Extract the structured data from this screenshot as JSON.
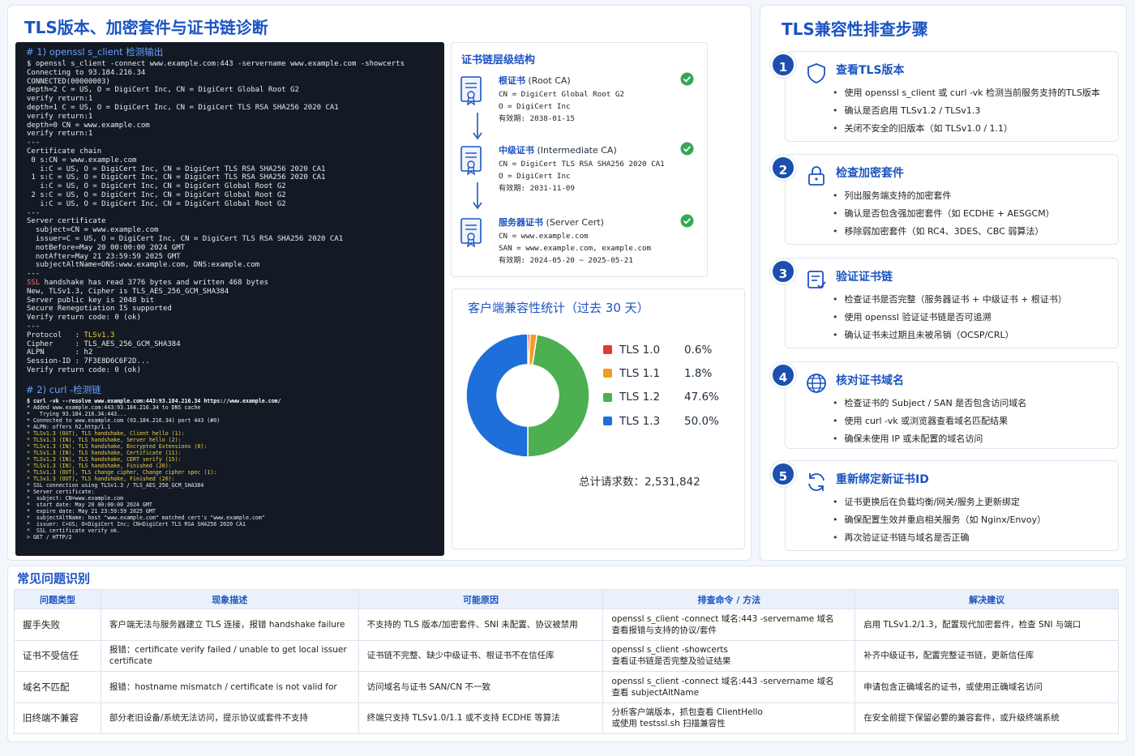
{
  "page_title": "TLS版本、加密套件与证书链诊断",
  "term": {
    "sec1": "# 1) openssl s_client 检测输出",
    "block1": "$ openssl s_client -connect www.example.com:443 -servername www.example.com -showcerts\nConnecting to 93.184.216.34\nCONNECTED(00000003)\ndepth=2 C = US, O = DigiCert Inc, CN = DigiCert Global Root G2\nverify return:1\ndepth=1 C = US, O = DigiCert Inc, CN = DigiCert TLS RSA SHA256 2020 CA1\nverify return:1\ndepth=0 CN = www.example.com\nverify return:1\n---\nCertificate chain\n 0 s:CN = www.example.com\n   i:C = US, O = DigiCert Inc, CN = DigiCert TLS RSA SHA256 2020 CA1\n 1 s:C = US, O = DigiCert Inc, CN = DigiCert TLS RSA SHA256 2020 CA1\n   i:C = US, O = DigiCert Inc, CN = DigiCert Global Root G2\n 2 s:C = US, O = DigiCert Inc, CN = DigiCert Global Root G2\n   i:C = US, O = DigiCert Inc, CN = DigiCert Global Root G2\n---\nServer certificate\n  subject=CN = www.example.com\n  issuer=C = US, O = DigiCert Inc, CN = DigiCert TLS RSA SHA256 2020 CA1\n  notBefore=May 20 00:00:00 2024 GMT\n  notAfter=May 21 23:59:59 2025 GMT\n  subjectAltName=DNS:www.example.com, DNS:example.com\n---",
    "ssl_kw": "SSL",
    "ssl_rest": " handshake has read 3776 bytes and written 468 bytes",
    "block2": "New, TLSv1.3, Cipher is TLS_AES_256_GCM_SHA384\nServer public key is 2048 bit\nSecure Renegotiation IS supported\nVerify return code: 0 (ok)\n---",
    "proto_label": "Protocol   : ",
    "proto_val": "TLSv1.3",
    "block3": "Cipher     : TLS_AES_256_GCM_SHA384\nALPN       : h2\nSession-ID : 7F3E8D6C6F2D...\nVerify return code: 0 (ok)",
    "sec2": "# 2) curl -检测链",
    "curl_cmd": "$ curl -vk --resolve www.example.com:443:93.184.216.34 https://www.example.com/",
    "curl_head": "* Added www.example.com:443:93.184.216.34 to DNS cache\n*   Trying 93.184.216.34:443...\n* Connected to www.example.com (93.184.216.34) port 443 (#0)\n* ALPN: offers h2,http/1.1",
    "curl_tls": "* TLSv1.3 (OUT), TLS handshake, Client hello (1):\n* TLSv1.3 (IN), TLS handshake, Server hello (2):\n* TLSv1.3 (IN), TLS handshake, Encrypted Extensions (8):\n* TLSv1.3 (IN), TLS handshake, Certificate (11):\n* TLSv1.3 (IN), TLS handshake, CERT verify (15):\n* TLSv1.3 (IN), TLS handshake, Finished (20):\n* TLSv1.3 (OUT), TLS change cipher, Change cipher spec (1):\n* TLSv1.3 (OUT), TLS handshake, Finished (20):",
    "curl_tail": "* SSL connection using TLSv1.3 / TLS_AES_256_GCM_SHA384\n* Server certificate:\n*  subject: CN=www.example.com\n*  start date: May 20 00:00:00 2024 GMT\n*  expire date: May 21 23:59:59 2025 GMT\n*  subjectAltName: host \"www.example.com\" matched cert's \"www.example.com\"\n*  issuer: C=US; O=DigiCert Inc; CN=DigiCert TLS RSA SHA256 2020 CA1\n*  SSL certificate verify ok.\n> GET / HTTP/2"
  },
  "chain": {
    "title": "证书链层级结构",
    "certs": [
      {
        "kind": "根证书",
        "en": "(Root CA)",
        "info": "CN = DigiCert Global Root G2\nO = DigiCert Inc\n有效期: 2038-01-15"
      },
      {
        "kind": "中级证书",
        "en": "(Intermediate CA)",
        "info": "CN = DigiCert TLS RSA SHA256 2020 CA1\nO = DigiCert Inc\n有效期: 2031-11-09"
      },
      {
        "kind": "服务器证书",
        "en": "(Server Cert)",
        "info": "CN = www.example.com\nSAN = www.example.com, example.com\n有效期: 2024-05-20 ~ 2025-05-21"
      }
    ]
  },
  "stats": {
    "title": "客户端兼容性统计（过去 30 天）",
    "total_label": "总计请求数：2,531,842"
  },
  "chart_data": {
    "type": "pie",
    "title": "客户端兼容性统计（过去 30 天）",
    "donut": true,
    "categories": [
      "TLS 1.0",
      "TLS 1.1",
      "TLS 1.2",
      "TLS 1.3"
    ],
    "values": [
      0.6,
      1.8,
      47.6,
      50.0
    ],
    "labels": [
      "0.6%",
      "1.8%",
      "47.6%",
      "50.0%"
    ],
    "colors": [
      "#e53935",
      "#f59a23",
      "#4caf50",
      "#1e6fd9"
    ],
    "legend_position": "right"
  },
  "right": {
    "title": "TLS兼容性排查步骤",
    "steps": [
      {
        "num": "1",
        "title": "查看TLS版本",
        "items": [
          "使用 openssl s_client 或 curl -vk 检测当前服务支持的TLS版本",
          "确认是否启用 TLSv1.2 / TLSv1.3",
          "关闭不安全的旧版本（如 TLSv1.0 / 1.1）"
        ]
      },
      {
        "num": "2",
        "title": "检查加密套件",
        "items": [
          "列出服务端支持的加密套件",
          "确认是否包含强加密套件（如 ECDHE + AESGCM）",
          "移除弱加密套件（如 RC4、3DES、CBC 弱算法）"
        ]
      },
      {
        "num": "3",
        "title": "验证证书链",
        "items": [
          "检查证书是否完整（服务器证书 + 中级证书 + 根证书）",
          "使用 openssl 验证证书链是否可追溯",
          "确认证书未过期且未被吊销（OCSP/CRL）"
        ]
      },
      {
        "num": "4",
        "title": "核对证书域名",
        "items": [
          "检查证书的 Subject / SAN 是否包含访问域名",
          "使用 curl -vk 或浏览器查看域名匹配结果",
          "确保未使用 IP 或未配置的域名访问"
        ]
      },
      {
        "num": "5",
        "title": "重新绑定新证书ID",
        "items": [
          "证书更换后在负载均衡/网关/服务上更新绑定",
          "确保配置生效并重启相关服务（如 Nginx/Envoy）",
          "再次验证证书链与域名是否正确"
        ]
      }
    ]
  },
  "problems": {
    "title": "常见问题识别",
    "headers": [
      "问题类型",
      "现象描述",
      "可能原因",
      "排查命令 / 方法",
      "解决建议"
    ],
    "rows": [
      [
        "握手失败",
        "客户端无法与服务器建立 TLS 连接，报错 handshake failure",
        "不支持的 TLS 版本/加密套件、SNI 未配置、协议被禁用",
        "openssl s_client -connect 域名:443 -servername 域名\n查看报错与支持的协议/套件",
        "启用 TLSv1.2/1.3，配置现代加密套件，检查 SNI 与端口"
      ],
      [
        "证书不受信任",
        "报错：certificate verify failed / unable to get local issuer certificate",
        "证书链不完整、缺少中级证书、根证书不在信任库",
        "openssl s_client -showcerts\n查看证书链是否完整及验证结果",
        "补齐中级证书，配置完整证书链，更新信任库"
      ],
      [
        "域名不匹配",
        "报错：hostname mismatch / certificate is not valid for",
        "访问域名与证书 SAN/CN 不一致",
        "openssl s_client -connect 域名:443 -servername 域名\n查看 subjectAltName",
        "申请包含正确域名的证书，或使用正确域名访问"
      ],
      [
        "旧终端不兼容",
        "部分老旧设备/系统无法访问，提示协议或套件不支持",
        "终端只支持 TLSv1.0/1.1 或不支持 ECDHE 等算法",
        "分析客户端版本，抓包查看 ClientHello\n或使用 testssl.sh 扫描兼容性",
        "在安全前提下保留必要的兼容套件，或升级终端系统"
      ]
    ]
  }
}
